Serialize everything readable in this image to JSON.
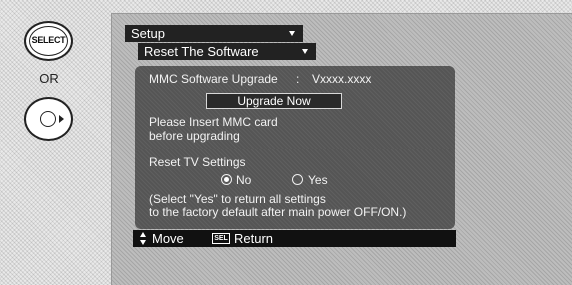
{
  "remote": {
    "select_label": "SELECT",
    "or_label": "OR"
  },
  "menu": {
    "setup_label": "Setup",
    "reset_label": "Reset The Software"
  },
  "upgrade_panel": {
    "label": "MMC Software Upgrade",
    "separator": ":",
    "version": "Vxxxx.xxxx",
    "button_label": "Upgrade Now",
    "note_line1": "Please Insert MMC card",
    "note_line2": "before upgrading"
  },
  "reset_panel": {
    "title": "Reset TV Settings",
    "options": [
      {
        "label": "No",
        "selected": true
      },
      {
        "label": "Yes",
        "selected": false
      }
    ],
    "help_line1": "(Select \"Yes\" to return all settings",
    "help_line2": "to the factory default after main power OFF/ON.)"
  },
  "footer": {
    "move_label": "Move",
    "sel_key": "SEL",
    "return_label": "Return"
  }
}
